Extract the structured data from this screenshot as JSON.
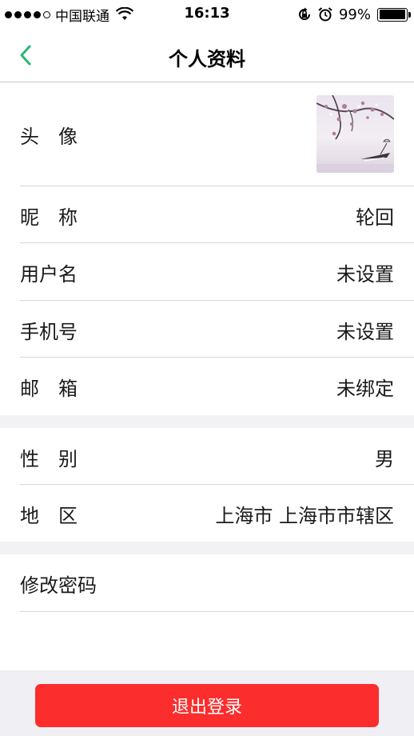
{
  "status_bar": {
    "carrier": "中国联通",
    "time": "16:13",
    "battery": "99%",
    "battery_level": 0.99
  },
  "nav": {
    "title": "个人资料",
    "back_icon": "chevron-left-icon",
    "accent_color": "#2bb673"
  },
  "profile": {
    "avatar_label": "头　像",
    "nickname_label": "昵　称",
    "nickname_value": "轮回",
    "username_label": "用户名",
    "username_value": "未设置",
    "phone_label": "手机号",
    "phone_value": "未设置",
    "email_label": "邮　箱",
    "email_value": "未绑定"
  },
  "info": {
    "gender_label": "性　别",
    "gender_value": "男",
    "region_label": "地　区",
    "region_value": "上海市 上海市市辖区"
  },
  "security": {
    "change_password_label": "修改密码"
  },
  "footer": {
    "logout_label": "退出登录",
    "logout_color": "#fc2d2d"
  }
}
